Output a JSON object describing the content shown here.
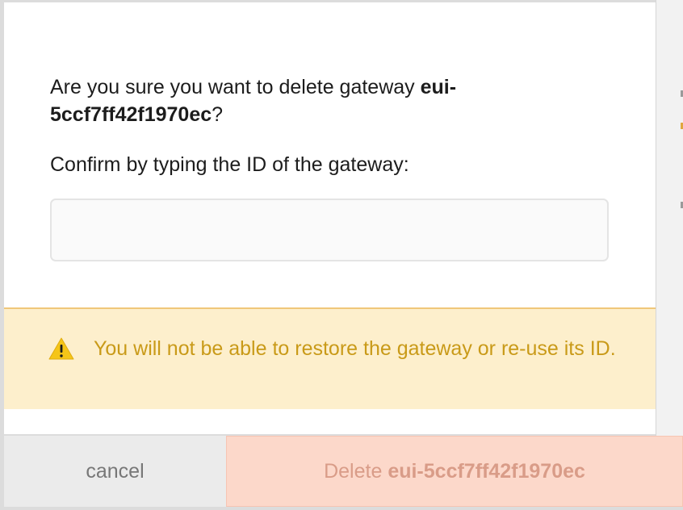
{
  "dialog": {
    "question_prefix": "Are you sure you want to delete gateway ",
    "gateway_id": "eui-5ccf7ff42f1970ec",
    "question_suffix": "?",
    "confirm_label": "Confirm by typing the ID of the gateway:",
    "input_value": "",
    "input_placeholder": "",
    "warning_text": "You will not be able to restore the gateway or re-use its ID.",
    "warning_icon": "warning-triangle-icon"
  },
  "footer": {
    "cancel_label": "cancel",
    "delete_prefix": "Delete ",
    "delete_id": "eui-5ccf7ff42f1970ec"
  },
  "colors": {
    "warning_bg": "#fdefcc",
    "warning_text": "#c99a18",
    "delete_bg_disabled": "#fcd8ca",
    "delete_text_disabled": "#d99c88"
  }
}
